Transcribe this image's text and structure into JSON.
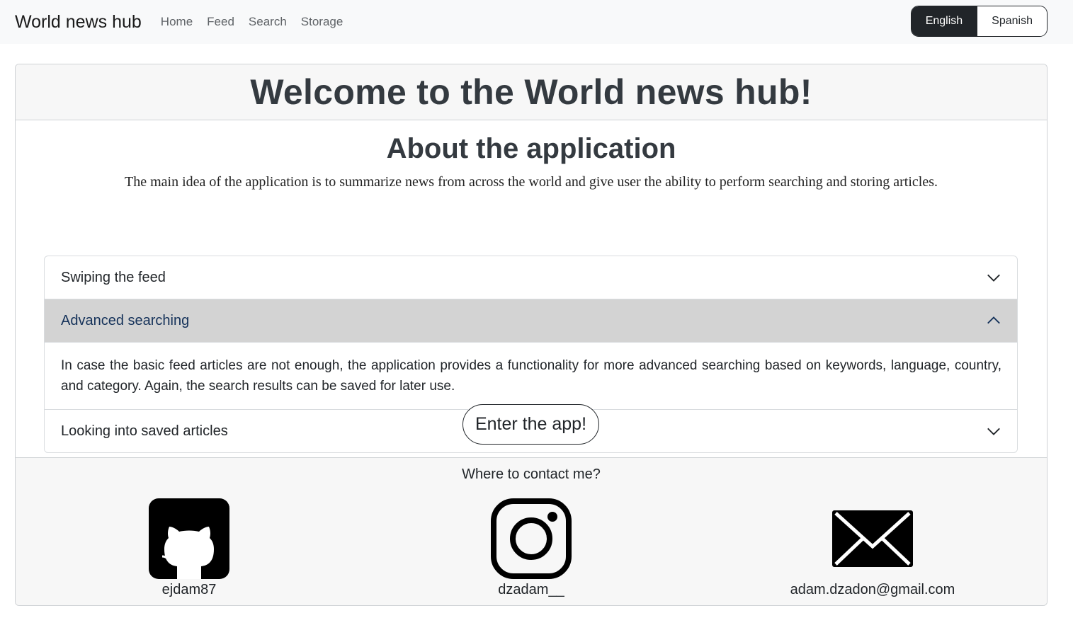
{
  "navbar": {
    "brand": "World news hub",
    "links": [
      "Home",
      "Feed",
      "Search",
      "Storage"
    ],
    "languages": [
      "English",
      "Spanish"
    ],
    "active_language": "English"
  },
  "header": {
    "title": "Welcome to the World news hub!"
  },
  "about": {
    "title": "About the application",
    "text": "The main idea of the application is to summarize news from across the world and give user the ability to perform searching and storing articles."
  },
  "accordion": {
    "items": [
      {
        "title": "Swiping the feed",
        "expanded": false
      },
      {
        "title": "Advanced searching",
        "expanded": true,
        "body": "In case the basic feed articles are not enough, the application provides a functionality for more advanced searching based on keywords, language, country, and category. Again, the search results can be saved for later use."
      },
      {
        "title": "Looking into saved articles",
        "expanded": false
      }
    ]
  },
  "enter_button": "Enter the app!",
  "footer": {
    "title": "Where to contact me?",
    "contacts": [
      {
        "icon": "github-icon",
        "label": "ejdam87"
      },
      {
        "icon": "instagram-icon",
        "label": "dzadam__"
      },
      {
        "icon": "envelope-icon",
        "label": "adam.dzadon@gmail.com"
      }
    ]
  },
  "colors": {
    "navbar_bg": "#f8f9fa",
    "dark": "#212529",
    "accordion_open_bg": "#d3d3d3",
    "accordion_open_text": "#15325a"
  }
}
